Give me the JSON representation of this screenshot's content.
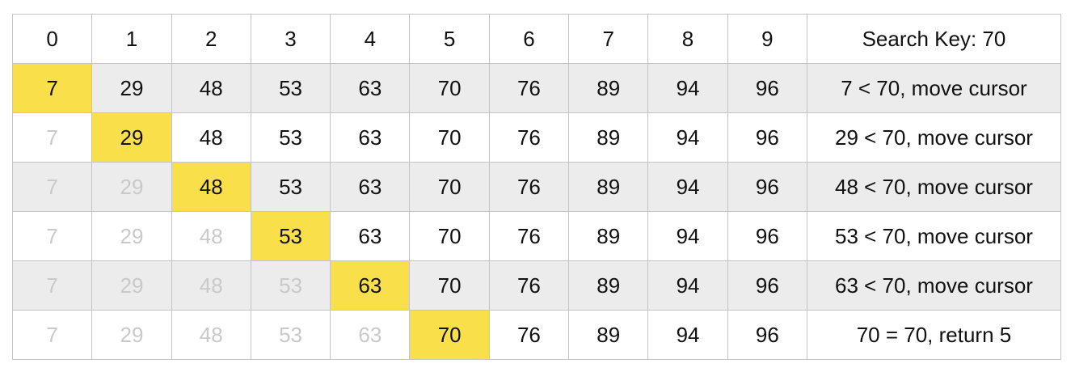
{
  "header": {
    "indices": [
      "0",
      "1",
      "2",
      "3",
      "4",
      "5",
      "6",
      "7",
      "8",
      "9"
    ],
    "search_key_label": "Search Key: 70"
  },
  "array_values": [
    "7",
    "29",
    "48",
    "53",
    "63",
    "70",
    "76",
    "89",
    "94",
    "96"
  ],
  "steps": [
    {
      "cursor": 0,
      "message": "7 < 70, move cursor"
    },
    {
      "cursor": 1,
      "message": "29 < 70, move cursor"
    },
    {
      "cursor": 2,
      "message": "48 < 70, move cursor"
    },
    {
      "cursor": 3,
      "message": "53 < 70, move cursor"
    },
    {
      "cursor": 4,
      "message": "63 < 70, move cursor"
    },
    {
      "cursor": 5,
      "message": "70 = 70, return 5"
    }
  ],
  "colors": {
    "cursor_highlight": "#f9e04b",
    "shaded_row": "#ececec",
    "visited_text": "#c9c9c9",
    "text": "#111111",
    "border": "#c4c4c4"
  }
}
